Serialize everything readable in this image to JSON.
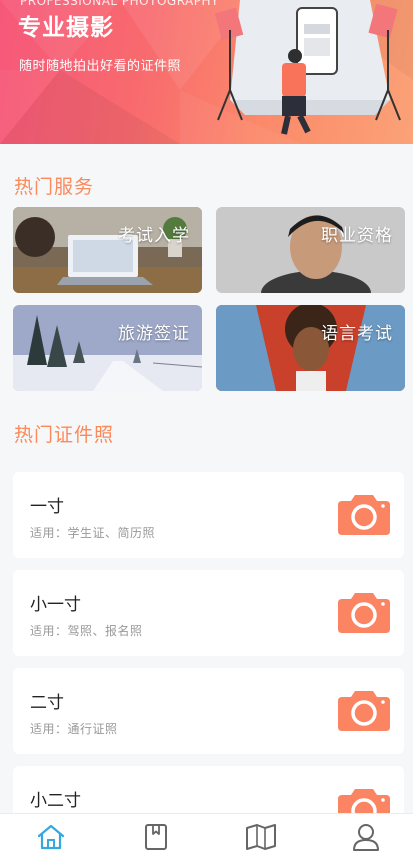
{
  "banner": {
    "en_title": "PROFESSIONAL PHOTOGRAPHY",
    "title": "专业摄影",
    "subtitle": "随时随地拍出好看的证件照"
  },
  "hot_services": {
    "title": "热门服务",
    "items": [
      {
        "label": "考试入学",
        "icon": "laptop-photo"
      },
      {
        "label": "职业资格",
        "icon": "man-portrait-photo"
      },
      {
        "label": "旅游签证",
        "icon": "snow-landscape-photo"
      },
      {
        "label": "语言考试",
        "icon": "woman-portrait-photo"
      }
    ]
  },
  "hot_photos": {
    "title": "热门证件照",
    "items": [
      {
        "name": "一寸",
        "usage": "适用：学生证、简历照",
        "icon": "camera-icon"
      },
      {
        "name": "小一寸",
        "usage": "适用：驾照、报名照",
        "icon": "camera-icon"
      },
      {
        "name": "二寸",
        "usage": "适用：通行证照",
        "icon": "camera-icon"
      },
      {
        "name": "小二寸",
        "usage": "",
        "icon": "camera-icon"
      }
    ]
  },
  "tabbar": {
    "tabs": [
      {
        "id": "home",
        "icon": "home-icon",
        "active": true
      },
      {
        "id": "album",
        "icon": "bookmark-book-icon",
        "active": false
      },
      {
        "id": "guide",
        "icon": "open-book-icon",
        "active": false
      },
      {
        "id": "me",
        "icon": "user-icon",
        "active": false
      }
    ]
  },
  "colors": {
    "accent": "#fb8a5b",
    "camera": "#fb8462",
    "tab_active": "#35a8e0",
    "tab_inactive": "#666666",
    "banner_start": "#f6587a",
    "banner_end": "#fba277"
  }
}
